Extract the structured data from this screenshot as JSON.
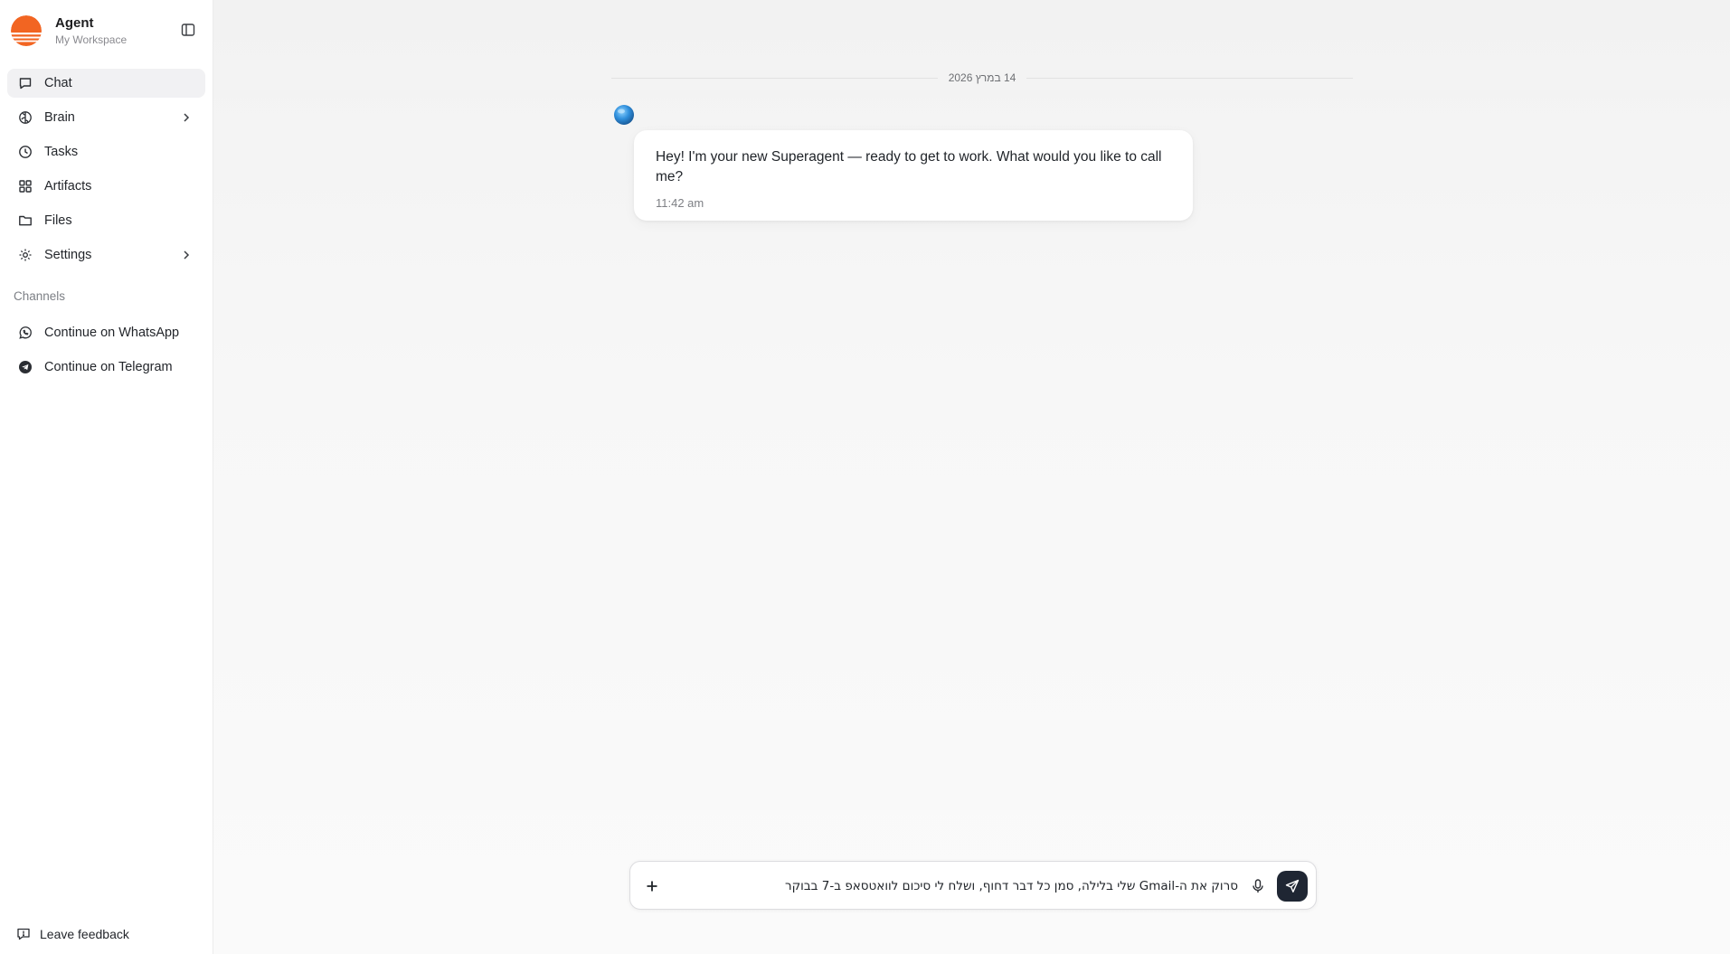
{
  "app": {
    "name": "Agent",
    "workspace": "My Workspace",
    "brand_color": "#f26522"
  },
  "sidebar": {
    "items": [
      {
        "label": "Chat",
        "icon": "chat-icon",
        "active": true
      },
      {
        "label": "Brain",
        "icon": "brain-icon",
        "expandable": true
      },
      {
        "label": "Tasks",
        "icon": "clock-icon"
      },
      {
        "label": "Artifacts",
        "icon": "grid-icon"
      },
      {
        "label": "Files",
        "icon": "folder-icon"
      },
      {
        "label": "Settings",
        "icon": "gear-icon",
        "expandable": true
      }
    ],
    "channels_label": "Channels",
    "channels": [
      {
        "label": "Continue on WhatsApp",
        "icon": "whatsapp-icon"
      },
      {
        "label": "Continue on Telegram",
        "icon": "telegram-icon"
      }
    ],
    "feedback_label": "Leave feedback"
  },
  "chat": {
    "date_separator": "14 במרץ 2026",
    "messages": [
      {
        "sender": "agent",
        "text": "Hey! I'm your new Superagent — ready to get to work. What would you like to call me?",
        "time": "11:42 am"
      }
    ]
  },
  "composer": {
    "value": "סרוק את ה-Gmail שלי בלילה, סמן כל דבר דחוף, ושלח לי סיכום לוואטסאפ ב-7 בבוקר",
    "send_button_color": "#1f2633"
  }
}
